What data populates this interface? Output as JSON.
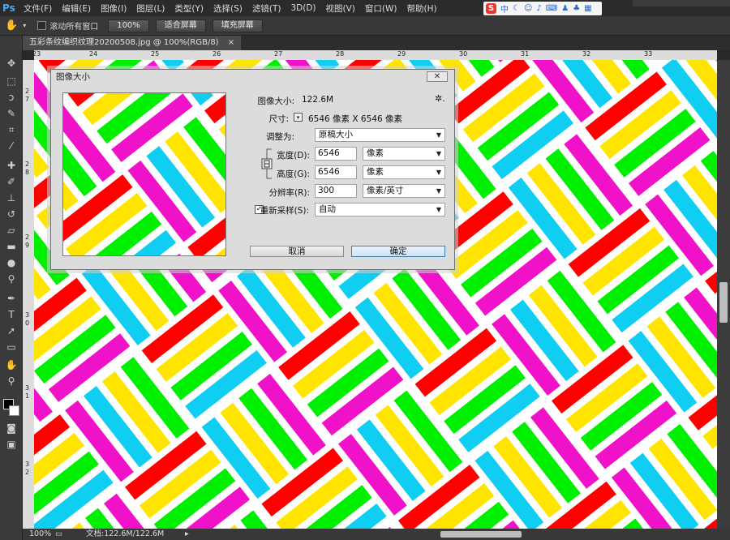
{
  "app": {
    "logo": "Ps"
  },
  "menu": [
    "文件(F)",
    "编辑(E)",
    "图像(I)",
    "图层(L)",
    "类型(Y)",
    "选择(S)",
    "滤镜(T)",
    "3D(D)",
    "视图(V)",
    "窗口(W)",
    "帮助(H)"
  ],
  "ime": {
    "logo": "S",
    "mode": "中",
    "icons": [
      "moon-icon",
      "smile-icon",
      "mic-icon",
      "keyboard-icon",
      "person-icon",
      "shirt-icon",
      "grid-icon"
    ]
  },
  "options": {
    "scroll_all_label": "滚动所有窗口",
    "zoom_btn": "100%",
    "fit_btn": "适合屏幕",
    "fill_btn": "填充屏幕"
  },
  "document": {
    "tab_title": "五彩条纹编织纹理20200508.jpg @ 100%(RGB/8)",
    "close": "×"
  },
  "ruler_top": [
    "23",
    "24",
    "25",
    "26",
    "27",
    "28",
    "29",
    "30",
    "31",
    "32",
    "33"
  ],
  "ruler_left": [
    "2",
    "7",
    "2",
    "8",
    "2",
    "9",
    "3",
    "0",
    "3",
    "1",
    "3",
    "2"
  ],
  "status": {
    "zoom": "100%",
    "doc": "文档:122.6M/122.6M"
  },
  "dialog": {
    "title": "图像大小",
    "close": "✕",
    "image_size_label": "图像大小:",
    "image_size_value": "122.6M",
    "dimensions_label": "尺寸:",
    "dimensions_value": "6546 像素  X  6546 像素",
    "fit_to_label": "调整为:",
    "fit_to_value": "原稿大小",
    "width_label": "宽度(D):",
    "width_value": "6546",
    "width_unit": "像素",
    "height_label": "高度(G):",
    "height_value": "6546",
    "height_unit": "像素",
    "resolution_label": "分辨率(R):",
    "resolution_value": "300",
    "resolution_unit": "像素/英寸",
    "resample_label": "重新采样(S):",
    "resample_value": "自动",
    "resample_checked": true,
    "cancel": "取消",
    "ok": "确定",
    "gear": "✲."
  },
  "colors": {
    "red": "#ff0000",
    "yellow": "#ffe400",
    "green": "#00ee00",
    "magenta": "#f012c8",
    "cyan": "#10cdf2",
    "ps_blue": "#4aa8f0"
  }
}
